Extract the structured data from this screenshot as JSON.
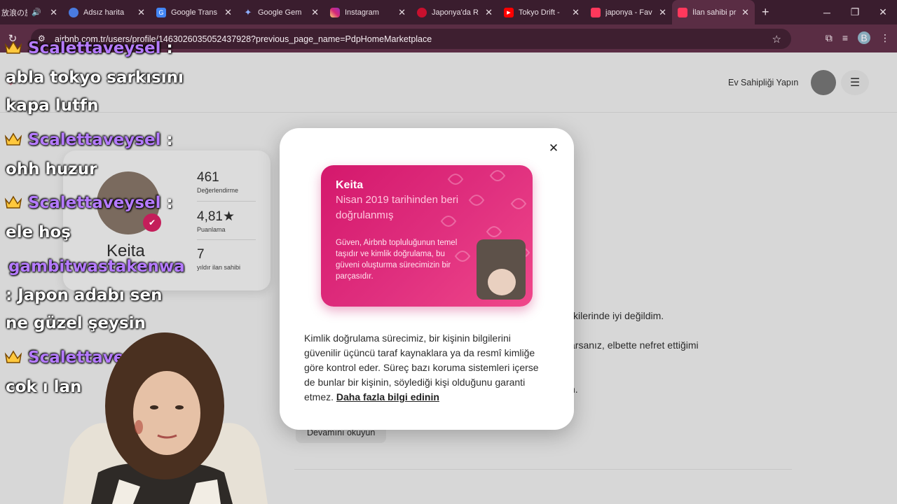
{
  "browser": {
    "tabs": [
      {
        "title": "放浪の旅",
        "icon": "audio-icon",
        "color": "#555555"
      },
      {
        "title": "Adsız harita",
        "icon": "maps-globe-icon",
        "color": "#4a7be0"
      },
      {
        "title": "Google Trans",
        "icon": "translate-icon",
        "color": "#4285f4"
      },
      {
        "title": "Google Gem",
        "icon": "gemini-icon",
        "color": "#7b8cf0"
      },
      {
        "title": "Instagram",
        "icon": "instagram-icon",
        "color": "#d62976"
      },
      {
        "title": "Japonya'da R",
        "icon": "site-icon",
        "color": "#c8102e"
      },
      {
        "title": "Tokyo Drift -",
        "icon": "youtube-icon",
        "color": "#ff0000"
      },
      {
        "title": "japonya - Fav",
        "icon": "airbnb-icon",
        "color": "#ff385c"
      },
      {
        "title": "İlan sahibi pr",
        "icon": "airbnb-icon",
        "color": "#ff385c"
      }
    ],
    "url": "airbnb.com.tr/users/profile/1463026035052437928?previous_page_name=PdpHomeMarketplace",
    "profile_initial": "B"
  },
  "page": {
    "host_link": "Ev Sahipliği Yapın",
    "profile": {
      "name": "Keita",
      "reviews_value": "461",
      "reviews_label": "Değerlendirme",
      "rating_value": "4,81★",
      "rating_label": "Puanlama",
      "years_value": "7",
      "years_label": "yıldır ilan sahibi"
    },
    "bg_line1": "kilerinde iyi değildim.",
    "bg_line2": "arsanız,  elbette nefret ettiğimi",
    "bg_line3": "n.",
    "read_more": "Devamını okuyun"
  },
  "modal": {
    "card_name": "Keita",
    "card_subtitle": "Nisan 2019 tarihinden beri doğrulanmış",
    "card_description": "Güven, Airbnb topluluğunun temel taşıdır ve kimlik doğrulama, bu güveni oluşturma sürecimizin bir parçasıdır.",
    "body_text": "Kimlik doğrulama sürecimiz, bir kişinin bilgilerini güvenilir üçüncü taraf kaynaklara ya da resmî kimliğe göre kontrol eder. Süreç bazı koruma sistemleri içerse de bunlar bir kişinin, söylediği kişi olduğunu garanti etmez.",
    "learn_more": "Daha fazla bilgi edinin"
  },
  "chat": {
    "messages": [
      {
        "user": "Scalettaveysel",
        "text1": "abla tokyo sarkısını",
        "text2": "kapa lutfn"
      },
      {
        "user": "Scalettaveysel",
        "text1": "ohh huzur"
      },
      {
        "user": "Scalettaveysel",
        "text1": "ele hoş"
      },
      {
        "user": "gambitwastakenwa",
        "text1": ": Japon adabı sen",
        "text2": "ne güzel şeysin"
      },
      {
        "user": "Scalettaveysel",
        "text1": "cok ı lan"
      }
    ]
  },
  "colors": {
    "airbnb_pink": "#d4186c",
    "chrome_dark": "#3a1d2e",
    "chrome_mid": "#5a2d44",
    "chat_user": "#b57bff"
  }
}
